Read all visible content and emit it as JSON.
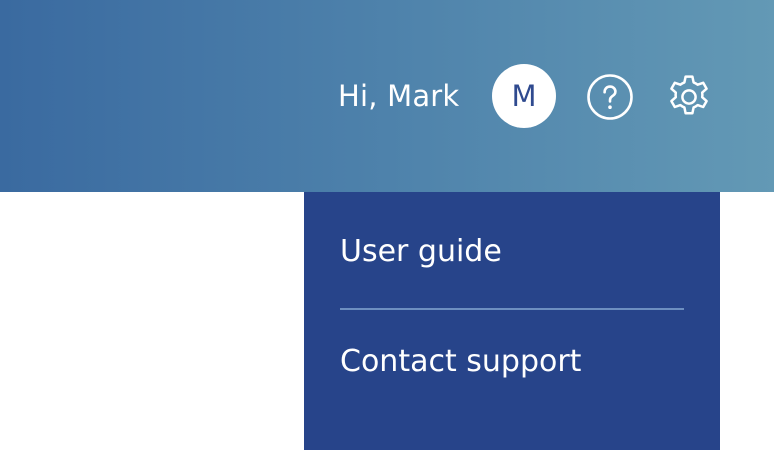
{
  "header": {
    "greeting": "Hi, Mark",
    "avatar_initial": "M",
    "help_icon": "question-circle-icon",
    "settings_icon": "gear-icon",
    "gradient_start": "#3a6aa0",
    "gradient_end": "#6399b5"
  },
  "help_menu": {
    "background": "#27448a",
    "items": [
      {
        "label": "User guide"
      },
      {
        "label": "Contact support"
      }
    ]
  }
}
